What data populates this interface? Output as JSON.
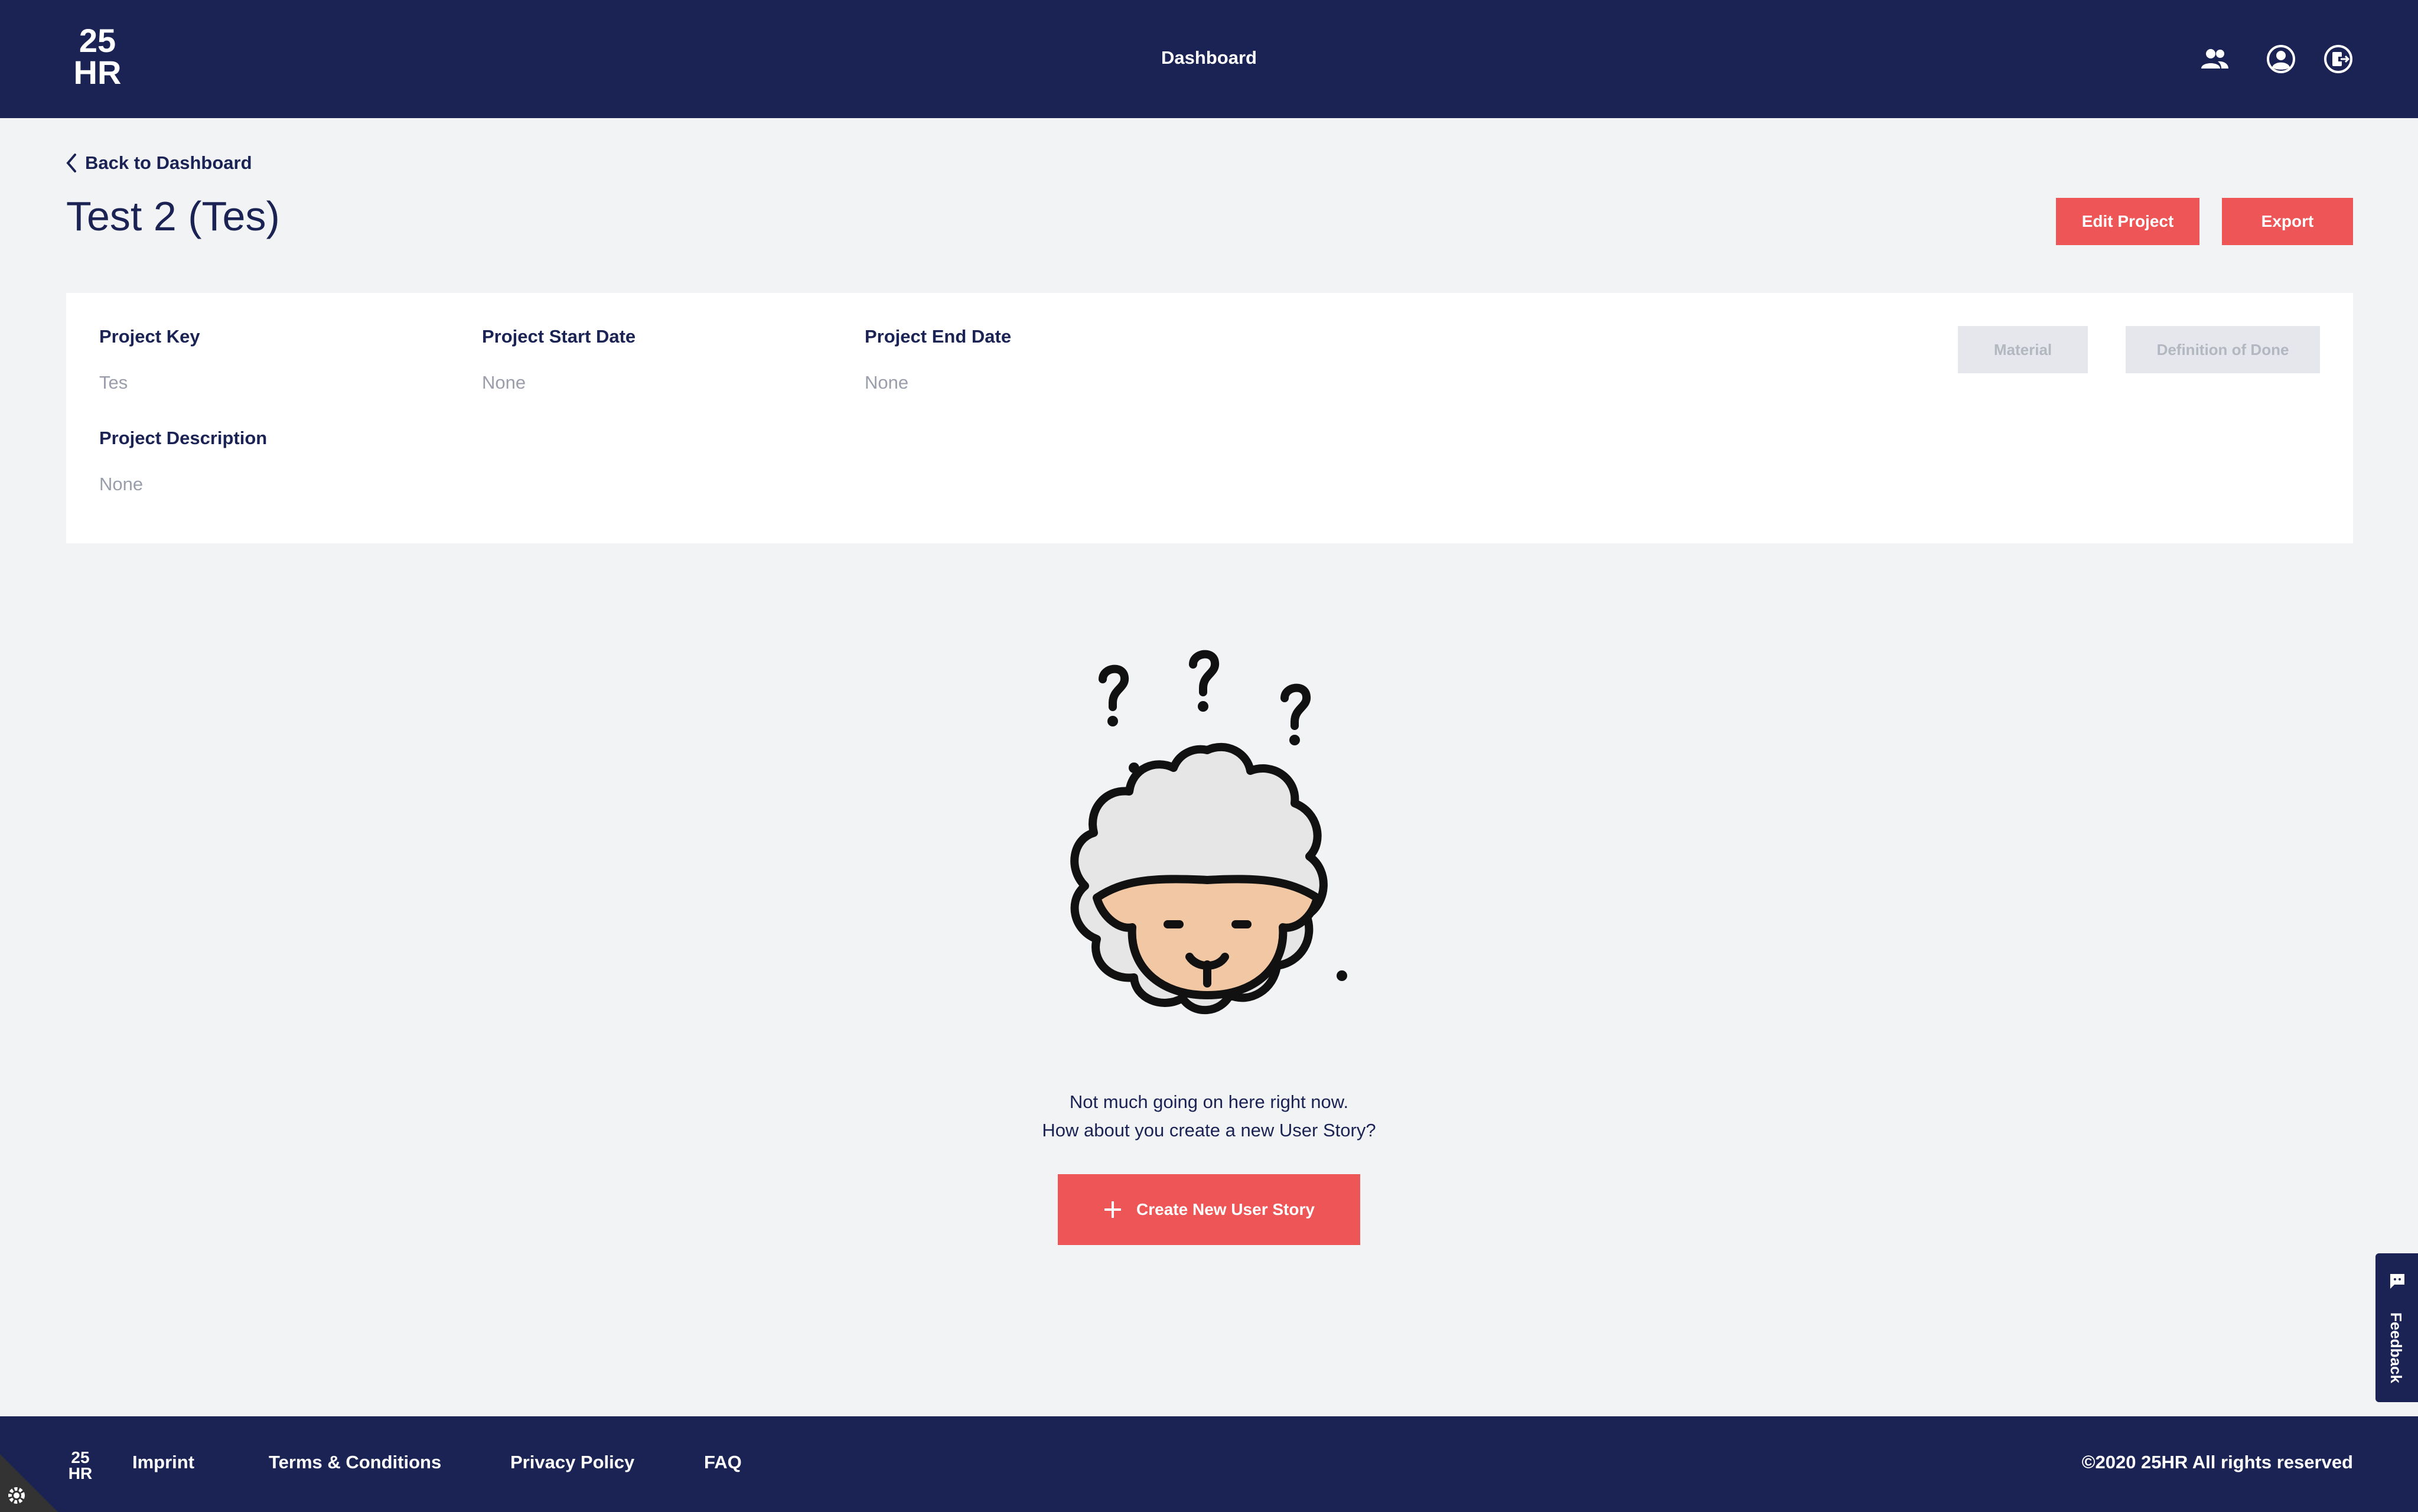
{
  "header": {
    "logo_top": "25",
    "logo_bottom": "HR",
    "title": "Dashboard",
    "icons": [
      "team-icon",
      "account-icon",
      "logout-icon"
    ]
  },
  "page": {
    "back_label": "Back to Dashboard",
    "title": "Test 2 (Tes)",
    "edit_button": "Edit Project",
    "export_button": "Export"
  },
  "project": {
    "key_label": "Project Key",
    "key_value": "Tes",
    "start_label": "Project Start Date",
    "start_value": "None",
    "end_label": "Project End Date",
    "end_value": "None",
    "description_label": "Project Description",
    "description_value": "None",
    "material_button": "Material",
    "dod_button": "Definition of Done"
  },
  "empty_state": {
    "line1": "Not much going on here right now.",
    "line2": "How about you create a new User Story?",
    "create_button": "Create New User Story"
  },
  "feedback": {
    "label": "Feedback"
  },
  "footer": {
    "logo_top": "25",
    "logo_bottom": "HR",
    "links": [
      "Imprint",
      "Terms & Conditions",
      "Privacy Policy",
      "FAQ"
    ],
    "copyright": "©2020 25HR All rights reserved"
  },
  "colors": {
    "navy": "#1a2353",
    "accent": "#ee5556",
    "background": "#f2f3f5",
    "disabled": "#e5e7ec"
  }
}
